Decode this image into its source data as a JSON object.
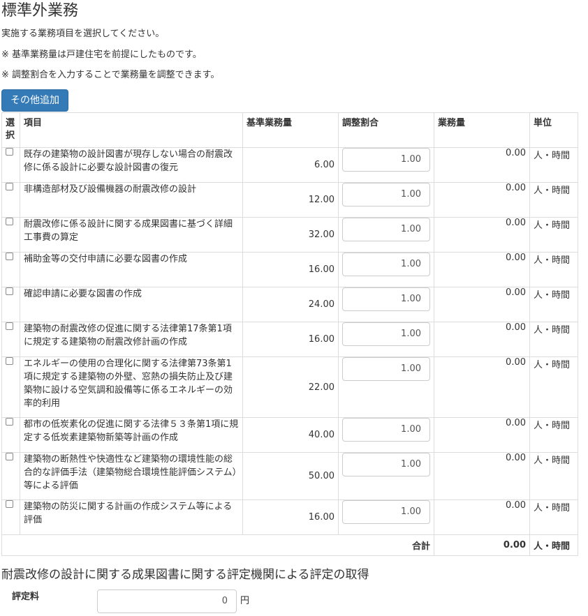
{
  "page": {
    "title": "標準外業務",
    "instructions": [
      "実施する業務項目を選択してください。",
      "※ 基準業務量は戸建住宅を前提にしたものです。",
      "※ 調整割合を入力することで業務量を調整できます。"
    ],
    "add_button_label": "その他追加"
  },
  "table": {
    "headers": {
      "select": "選択",
      "item": "項目",
      "base_volume": "基準業務量",
      "adjust_ratio": "調整割合",
      "volume": "業務量",
      "unit": "単位"
    },
    "rows": [
      {
        "item": "既存の建築物の設計図書が現存しない場合の耐震改修に係る設計に必要な設計図書の復元",
        "base": "6.00",
        "ratio": "1.00",
        "volume": "0.00",
        "unit": "人・時間",
        "checked": false
      },
      {
        "item": "非構造部材及び設備機器の耐震改修の設計",
        "base": "12.00",
        "ratio": "1.00",
        "volume": "0.00",
        "unit": "人・時間",
        "checked": false
      },
      {
        "item": "耐震改修に係る設計に関する成果図書に基づく詳細工事費の算定",
        "base": "32.00",
        "ratio": "1.00",
        "volume": "0.00",
        "unit": "人・時間",
        "checked": false
      },
      {
        "item": "補助金等の交付申請に必要な図書の作成",
        "base": "16.00",
        "ratio": "1.00",
        "volume": "0.00",
        "unit": "人・時間",
        "checked": false
      },
      {
        "item": "確認申請に必要な図書の作成",
        "base": "24.00",
        "ratio": "1.00",
        "volume": "0.00",
        "unit": "人・時間",
        "checked": false
      },
      {
        "item": "建築物の耐震改修の促進に関する法律第17条第1項に規定する建築物の耐震改修計画の作成",
        "base": "16.00",
        "ratio": "1.00",
        "volume": "0.00",
        "unit": "人・時間",
        "checked": false
      },
      {
        "item": "エネルギーの使用の合理化に関する法律第73条第1項に規定する建築物の外壁、窓熱の損失防止及び建築物に設ける空気調和設備等に係るエネルギーの効率的利用",
        "base": "22.00",
        "ratio": "1.00",
        "volume": "0.00",
        "unit": "人・時間",
        "checked": false
      },
      {
        "item": "都市の低炭素化の促進に関する法律５３条第1項に規定する低炭素建築物新築等計画の作成",
        "base": "40.00",
        "ratio": "1.00",
        "volume": "0.00",
        "unit": "人・時間",
        "checked": false
      },
      {
        "item": "建築物の断熱性や快適性など建築物の環境性能の総合的な評価手法（建築物総合環境性能評価システム）等による評価",
        "base": "50.00",
        "ratio": "1.00",
        "volume": "0.00",
        "unit": "人・時間",
        "checked": false
      },
      {
        "item": "建築物の防災に関する計画の作成システム等による評価",
        "base": "16.00",
        "ratio": "1.00",
        "volume": "0.00",
        "unit": "人・時間",
        "checked": false
      }
    ],
    "total": {
      "label": "合計",
      "volume": "0.00",
      "unit": "人・時間"
    }
  },
  "evaluation": {
    "section_title": "耐震改修の設計に関する成果図書に関する評定機関による評定の取得",
    "fee_label": "評定料",
    "fee_value": "0",
    "fee_unit": "円"
  }
}
